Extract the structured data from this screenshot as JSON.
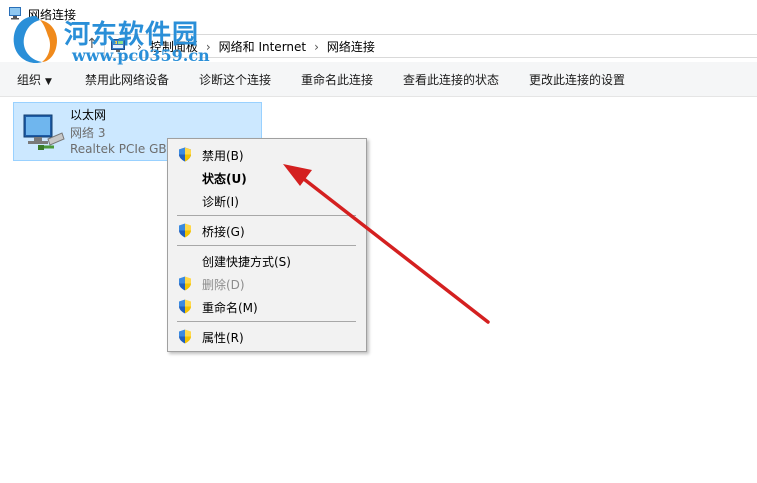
{
  "window": {
    "title": "网络连接"
  },
  "watermark": {
    "name": "河东软件园",
    "url": "www.pc0359.cn"
  },
  "address": {
    "crumbs": [
      "控制面板",
      "网络和 Internet",
      "网络连接"
    ]
  },
  "toolbar": {
    "organize": "组织",
    "disable_device": "禁用此网络设备",
    "diagnose": "诊断这个连接",
    "rename": "重命名此连接",
    "view_status": "查看此连接的状态",
    "change_settings": "更改此连接的设置"
  },
  "adapter": {
    "name": "以太网",
    "network": "网络  3",
    "device": "Realtek PCIe GBE"
  },
  "context_menu": {
    "disable": "禁用(B)",
    "status": "状态(U)",
    "diagnose": "诊断(I)",
    "bridge": "桥接(G)",
    "shortcut": "创建快捷方式(S)",
    "delete": "删除(D)",
    "rename": "重命名(M)",
    "properties": "属性(R)"
  },
  "colors": {
    "selection_bg": "#cce8ff",
    "selection_border": "#99d1ff",
    "annotation_arrow": "#d42020",
    "watermark": "#2a8fd8"
  }
}
